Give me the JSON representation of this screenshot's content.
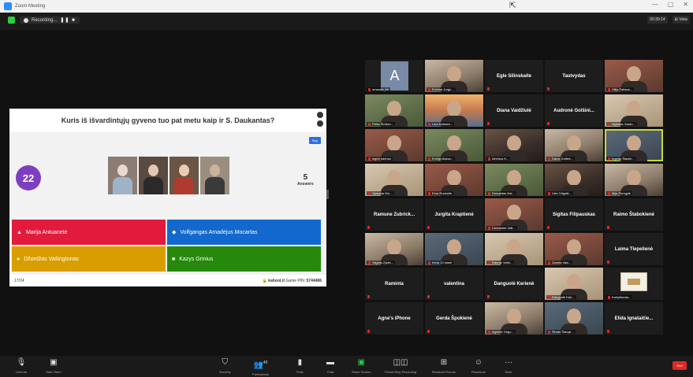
{
  "window": {
    "title": "Zoom Meeting"
  },
  "recording": {
    "label": "Recording...",
    "controls": "❚❚  ■"
  },
  "topright": {
    "time_chip": "00:30:14",
    "view_label": "View"
  },
  "kahoot": {
    "question": "Kuris iš išvardintųjų gyveno tuo pat metu kaip ir S. Daukantas?",
    "skip_label": "Skip",
    "timer": "22",
    "answers_count": "5",
    "answers_label": "Answers",
    "options": [
      {
        "label": "Marija Antuanetė",
        "symbol": "▲"
      },
      {
        "label": "Volfgangas Amadėjus Mocartas",
        "symbol": "◆"
      },
      {
        "label": "Džordžas Vašingtonas",
        "symbol": "●"
      },
      {
        "label": "Kazys Grinius",
        "symbol": "■"
      }
    ],
    "progress": "17/24",
    "brand": "kahoot.it",
    "pin_label": "Game PIN:",
    "pin": "5744486"
  },
  "gallery": {
    "tiles": [
      {
        "name": "amanda_kh",
        "kind": "avatar",
        "initial": "A"
      },
      {
        "name": "Evelina Jurgu...",
        "kind": "video"
      },
      {
        "name": "Egle Silinskaite",
        "kind": "name"
      },
      {
        "name": "Tautvydas",
        "kind": "name"
      },
      {
        "name": "Vilija Paltaus...",
        "kind": "video"
      },
      {
        "name": "Fielia Šimkev...",
        "kind": "video"
      },
      {
        "name": "Lina Kašauci...",
        "kind": "video"
      },
      {
        "name": "Diana Vaidžiulė",
        "kind": "name"
      },
      {
        "name": "Audronė Golšini...",
        "kind": "name"
      },
      {
        "name": "Algirdas Juodo...",
        "kind": "video"
      },
      {
        "name": "ingrid karinan",
        "kind": "video"
      },
      {
        "name": "Emilija Bakuz...",
        "kind": "video"
      },
      {
        "name": "Alminus K...",
        "kind": "video"
      },
      {
        "name": "Daiva Golšini...",
        "kind": "video"
      },
      {
        "name": "Ingrida Šiaulie...",
        "kind": "video"
      },
      {
        "name": "Vytautas Kin...",
        "kind": "video"
      },
      {
        "name": "Ema Rudzaite",
        "kind": "video"
      },
      {
        "name": "Domantas Ibiz...",
        "kind": "video"
      },
      {
        "name": "Urte Grigaiti...",
        "kind": "video"
      },
      {
        "name": "Mija Plungytė",
        "kind": "video"
      },
      {
        "name": "Ramune Zubrick...",
        "kind": "name"
      },
      {
        "name": "Jurgita Kraptienė",
        "kind": "name"
      },
      {
        "name": "Domantas Vatt...",
        "kind": "video"
      },
      {
        "name": "Sigitas Filipauskas",
        "kind": "name"
      },
      {
        "name": "Raimo Štabokienė",
        "kind": "name"
      },
      {
        "name": "Vilgaila Zylab...",
        "kind": "video"
      },
      {
        "name": "Irena 10 klasė",
        "kind": "video"
      },
      {
        "name": "Danute Veikt...",
        "kind": "video"
      },
      {
        "name": "Zaneta Vaic...",
        "kind": "video"
      },
      {
        "name": "Laima Tiepelienė",
        "kind": "name"
      },
      {
        "name": "Raminta",
        "kind": "name"
      },
      {
        "name": "valentina",
        "kind": "name"
      },
      {
        "name": "Danguolė Kerienė",
        "kind": "name"
      },
      {
        "name": "Danguolė Kari...",
        "kind": "video"
      },
      {
        "name": "Karlyštanda...",
        "kind": "book"
      },
      {
        "name": "Agne's iPhone",
        "kind": "name"
      },
      {
        "name": "Gerda Špokienė",
        "kind": "name"
      },
      {
        "name": "Agnietė Gegu...",
        "kind": "video"
      },
      {
        "name": "Šimas Štavyti...",
        "kind": "video"
      },
      {
        "name": "Elida Ignataičie...",
        "kind": "name"
      }
    ]
  },
  "toolbar": {
    "unmute": "Unmute",
    "start_video": "Start Video",
    "security": "Security",
    "participants": "Participants",
    "participants_count": "40",
    "polls": "Polls",
    "chat": "Chat",
    "share": "Share Screen",
    "record": "Pause/Stop Recording",
    "breakout": "Breakout Rooms",
    "reactions": "Reactions",
    "more": "More",
    "end": "End"
  }
}
